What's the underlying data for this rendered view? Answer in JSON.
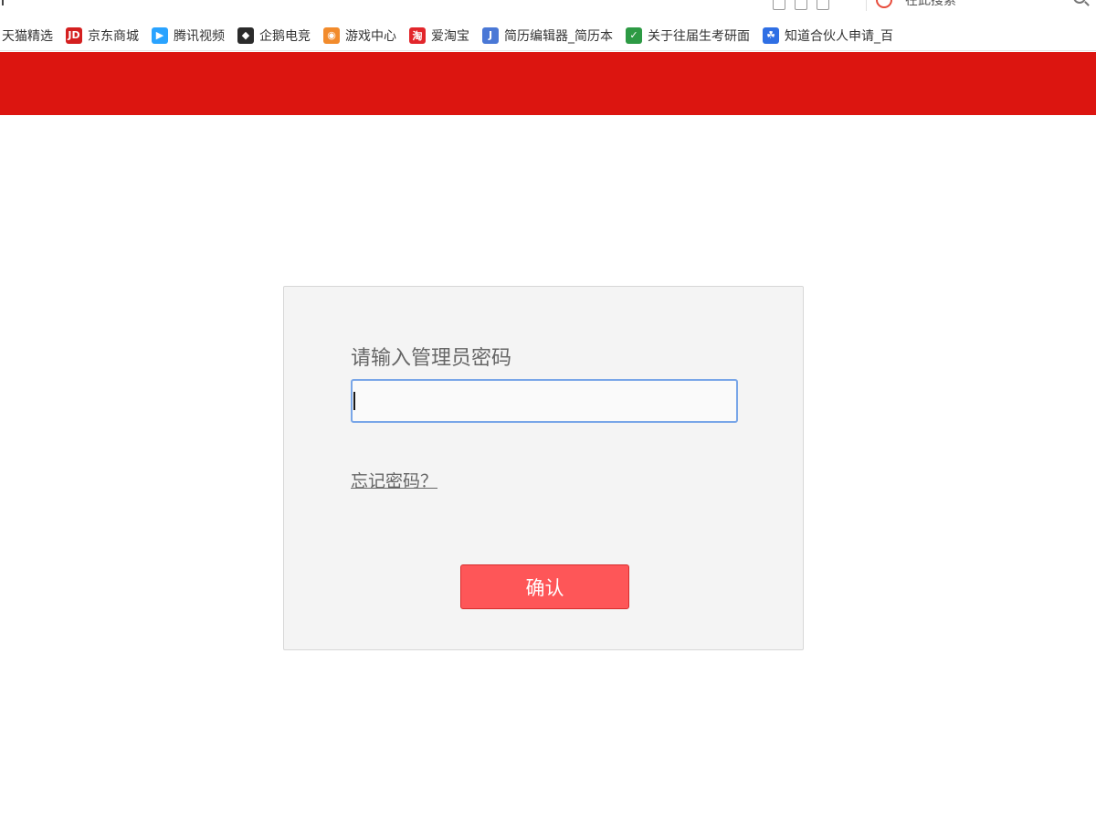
{
  "browser": {
    "search_placeholder": "在此搜索"
  },
  "bookmarks": [
    {
      "label": "天猫精选",
      "icon": "tmall-icon",
      "color": "#ffffff",
      "glyph": ""
    },
    {
      "label": "京东商城",
      "icon": "jd-icon",
      "color": "#d41f1f",
      "glyph": "JD"
    },
    {
      "label": "腾讯视频",
      "icon": "tencent-video-icon",
      "color": "#2aa3ff",
      "glyph": "▶"
    },
    {
      "label": "企鹅电竞",
      "icon": "penguin-esports-icon",
      "color": "#2b2b2b",
      "glyph": "◆"
    },
    {
      "label": "游戏中心",
      "icon": "game-center-icon",
      "color": "#f28b2c",
      "glyph": "◉"
    },
    {
      "label": "爱淘宝",
      "icon": "aitaobao-icon",
      "color": "#e2262b",
      "glyph": "淘"
    },
    {
      "label": "简历编辑器_简历本",
      "icon": "resume-editor-icon",
      "color": "#4a78d6",
      "glyph": "J"
    },
    {
      "label": "关于往届生考研面",
      "icon": "leaf-icon",
      "color": "#2d9a44",
      "glyph": "✓"
    },
    {
      "label": "知道合伙人申请_百",
      "icon": "baidu-paw-icon",
      "color": "#2f6fe4",
      "glyph": "☘"
    }
  ],
  "header": {
    "bar_color": "#dc1510"
  },
  "login": {
    "prompt": "请输入管理员密码",
    "password_value": "",
    "forgot_link": "忘记密码？",
    "confirm_label": "确认",
    "confirm_color": "#fe5658"
  }
}
